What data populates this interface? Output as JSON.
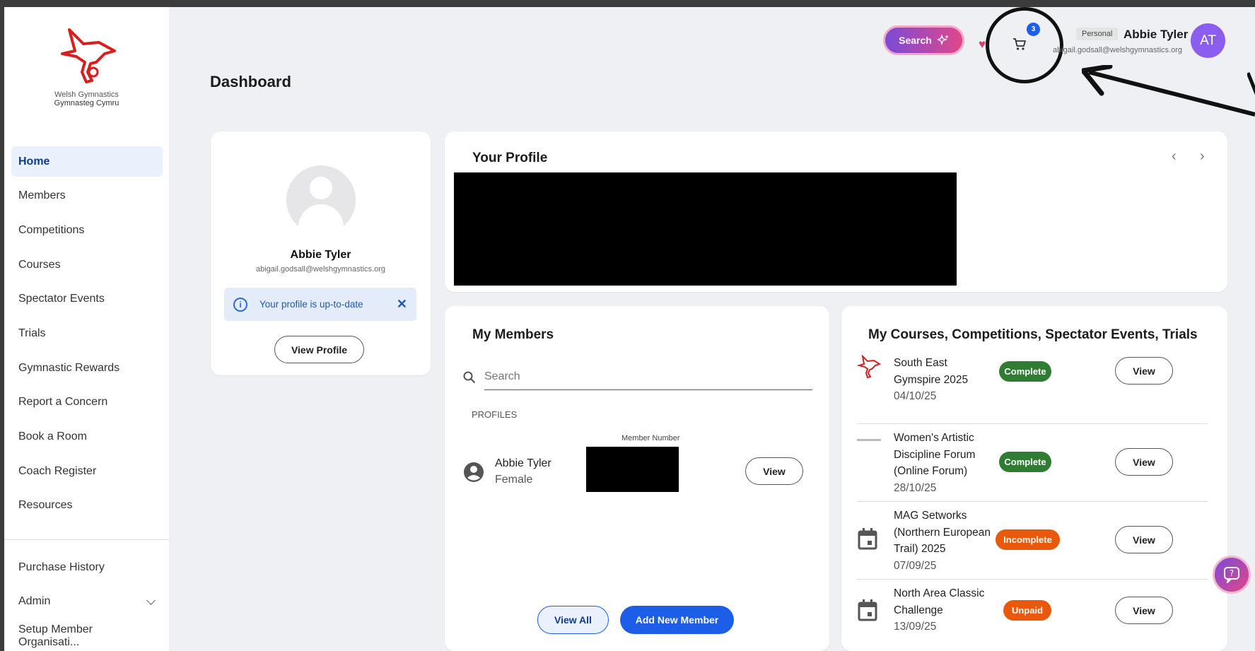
{
  "logo": {
    "line1": "Welsh Gymnastics",
    "line2": "Gymnasteg Cymru"
  },
  "sidebar": {
    "items": [
      {
        "label": "Home",
        "active": true
      },
      {
        "label": "Members"
      },
      {
        "label": "Competitions"
      },
      {
        "label": "Courses"
      },
      {
        "label": "Spectator Events"
      },
      {
        "label": "Trials"
      },
      {
        "label": "Gymnastic Rewards"
      },
      {
        "label": "Report a Concern"
      },
      {
        "label": "Book a Room"
      },
      {
        "label": "Coach Register"
      },
      {
        "label": "Resources"
      }
    ],
    "secondary": [
      {
        "label": "Purchase History"
      },
      {
        "label": "Admin"
      },
      {
        "label": "Setup Member Organisati..."
      }
    ]
  },
  "page": {
    "title": "Dashboard"
  },
  "topbar": {
    "search_label": "Search",
    "cart_count": "3",
    "account_type": "Personal",
    "user_name": "Abbie Tyler",
    "user_email": "abigail.godsall@welshgymnastics.org",
    "avatar_initials": "AT"
  },
  "profile_card": {
    "name": "Abbie Tyler",
    "email": "abigail.godsall@welshgymnastics.org",
    "alert": "Your profile is up-to-date",
    "button": "View Profile"
  },
  "your_profile": {
    "title": "Your Profile"
  },
  "my_members": {
    "title": "My Members",
    "search_placeholder": "Search",
    "section_label": "PROFILES",
    "column_header": "Member Number",
    "member": {
      "name": "Abbie Tyler",
      "gender": "Female",
      "view": "View"
    },
    "view_all": "View All",
    "add_new": "Add New Member"
  },
  "courses": {
    "title": "My Courses, Competitions, Spectator Events, Trials",
    "items": [
      {
        "line1": "South East",
        "line2": "Gymspire 2025",
        "line3": "",
        "date": "04/10/25",
        "status": "Complete",
        "view": "View"
      },
      {
        "line1": "Women's Artistic",
        "line2": "Discipline Forum",
        "line3": "(Online Forum)",
        "date": "28/10/25",
        "status": "Complete",
        "view": "View"
      },
      {
        "line1": "MAG Setworks",
        "line2": "(Northern European",
        "line3": "Trail) 2025",
        "date": "07/09/25",
        "status": "Incomplete",
        "view": "View"
      },
      {
        "line1": "North Area Classic",
        "line2": "Challenge",
        "line3": "",
        "date": "13/09/25",
        "status": "Unpaid",
        "view": "View"
      }
    ]
  },
  "colors": {
    "primary": "#1c5ee8",
    "complete": "#2e7d32",
    "incomplete": "#e8590c",
    "avatar": "#8c5ef0"
  }
}
